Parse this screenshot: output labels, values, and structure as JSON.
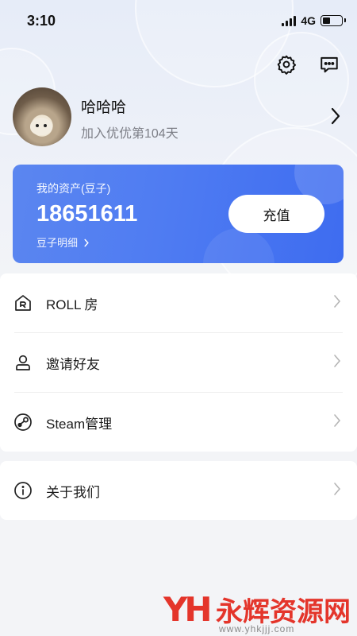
{
  "status_bar": {
    "time": "3:10",
    "network": "4G"
  },
  "header": {
    "settings_icon": "gear-icon",
    "message_icon": "chat-bubble-icon"
  },
  "profile": {
    "username": "哈哈哈",
    "join_text": "加入优优第104天"
  },
  "assets": {
    "label": "我的资产(豆子)",
    "value": "18651611",
    "detail_link": "豆子明细",
    "recharge_label": "充值",
    "accent_color": "#4f7cf2"
  },
  "menu": {
    "items": [
      {
        "label": "ROLL 房",
        "icon": "roll-room-icon"
      },
      {
        "label": "邀请好友",
        "icon": "user-icon"
      },
      {
        "label": "Steam管理",
        "icon": "steam-icon"
      }
    ],
    "about": {
      "label": "关于我们",
      "icon": "info-icon"
    }
  },
  "watermark": {
    "logo": "YH",
    "text": "永辉资源网",
    "url": "www.yhkjjj.com"
  }
}
